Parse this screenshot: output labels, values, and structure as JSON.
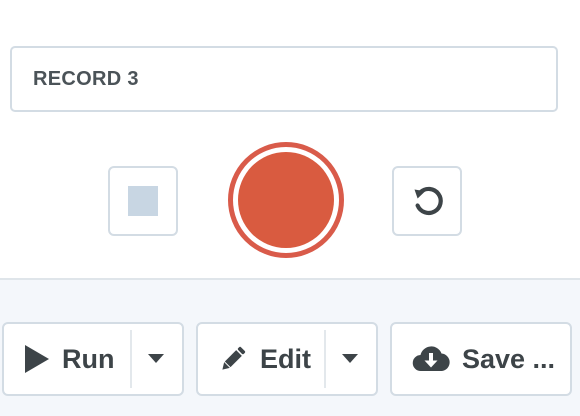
{
  "recording": {
    "name_value": "RECORD 3",
    "stop_icon": "stop-square-icon",
    "record_icon": "record-circle-icon",
    "reset_icon": "rotate-ccw-icon",
    "record_color": "#d95b40"
  },
  "toolbar": {
    "run_label": "Run",
    "edit_label": "Edit",
    "save_label": "Save ...",
    "run_icon": "play-icon",
    "edit_icon": "pencil-icon",
    "save_icon": "cloud-download-icon",
    "caret_icon": "caret-down-icon"
  }
}
